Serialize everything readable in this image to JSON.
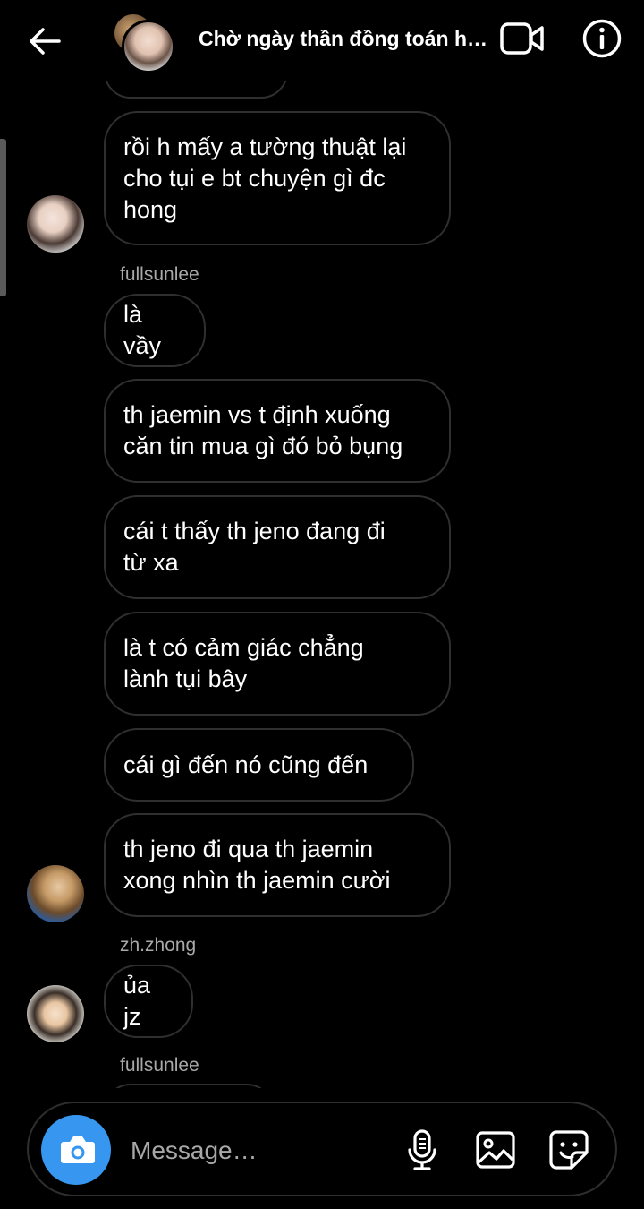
{
  "header": {
    "title": "Chờ ngày thần đồng toán h…"
  },
  "composer": {
    "placeholder": "Message…"
  },
  "messages": [
    {
      "text": "rồi h mấy a tường thuật lại\ncho tụi e bt chuyện gì đc\nhong"
    },
    {
      "sender": "fullsunlee",
      "text": "là vầy"
    },
    {
      "text": "th jaemin vs t định xuống\ncăn tin mua gì đó bỏ bụng"
    },
    {
      "text": "cái t thấy th jeno đang đi\ntừ xa"
    },
    {
      "text": "là t có cảm giác chẳng\nlành tụi bây"
    },
    {
      "text": "cái gì đến nó cũng đến"
    },
    {
      "text": "th jeno đi qua th jaemin\nxong nhìn th jaemin cười"
    },
    {
      "sender": "zh.zhong",
      "text": "ủa jz"
    },
    {
      "sender": "fullsunlee"
    }
  ],
  "icons": {
    "back": "arrow-left-icon",
    "video": "video-camera-icon",
    "info": "info-icon",
    "camera": "camera-icon",
    "mic": "microphone-icon",
    "gallery": "image-icon",
    "sticker": "sticker-icon"
  },
  "colors": {
    "background": "#000000",
    "bubble_border": "#2f2f2f",
    "sender_text": "#a8a8a8",
    "accent": "#3797f0"
  }
}
